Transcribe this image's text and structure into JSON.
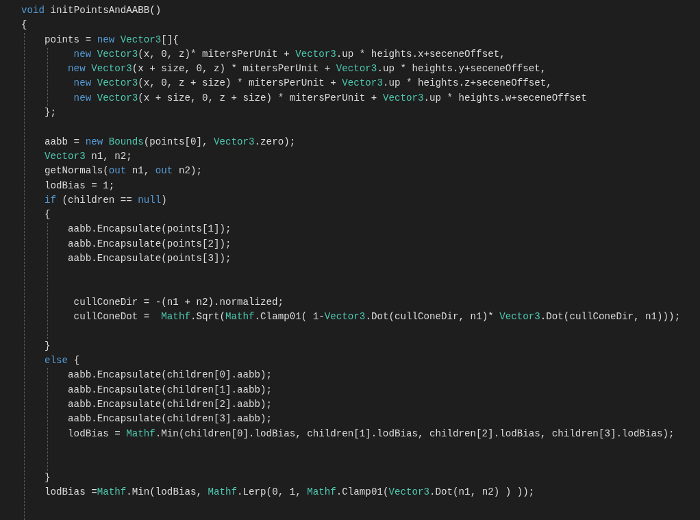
{
  "editor": {
    "lines": [
      {
        "kind": "code",
        "tokens": [
          {
            "kind": "k",
            "text": "void"
          },
          {
            "kind": "p",
            "text": " initPointsAndAABB()"
          }
        ]
      },
      {
        "kind": "code",
        "tokens": [
          {
            "kind": "p",
            "text": "{"
          }
        ]
      },
      {
        "kind": "code",
        "tokens": [
          {
            "kind": "p",
            "text": "    points = "
          },
          {
            "kind": "k",
            "text": "new"
          },
          {
            "kind": "t",
            "text": " Vector3"
          },
          {
            "kind": "p",
            "text": "[]{"
          }
        ]
      },
      {
        "kind": "code",
        "tokens": [
          {
            "kind": "k",
            "text": "         new"
          },
          {
            "kind": "t",
            "text": " Vector3"
          },
          {
            "kind": "p",
            "text": "(x, 0, z)* mitersPerUnit + "
          },
          {
            "kind": "t",
            "text": "Vector3"
          },
          {
            "kind": "p",
            "text": ".up * heights.x+seceneOffset,"
          }
        ]
      },
      {
        "kind": "code",
        "tokens": [
          {
            "kind": "k",
            "text": "        new"
          },
          {
            "kind": "t",
            "text": " Vector3"
          },
          {
            "kind": "p",
            "text": "(x + size, 0, z) * mitersPerUnit + "
          },
          {
            "kind": "t",
            "text": "Vector3"
          },
          {
            "kind": "p",
            "text": ".up * heights.y+seceneOffset,"
          }
        ]
      },
      {
        "kind": "code",
        "tokens": [
          {
            "kind": "k",
            "text": "         new"
          },
          {
            "kind": "t",
            "text": " Vector3"
          },
          {
            "kind": "p",
            "text": "(x, 0, z + size) * mitersPerUnit + "
          },
          {
            "kind": "t",
            "text": "Vector3"
          },
          {
            "kind": "p",
            "text": ".up * heights.z+seceneOffset,"
          }
        ]
      },
      {
        "kind": "code",
        "tokens": [
          {
            "kind": "k",
            "text": "         new"
          },
          {
            "kind": "t",
            "text": " Vector3"
          },
          {
            "kind": "p",
            "text": "(x + size, 0, z + size) * mitersPerUnit + "
          },
          {
            "kind": "t",
            "text": "Vector3"
          },
          {
            "kind": "p",
            "text": ".up * heights.w+seceneOffset"
          }
        ]
      },
      {
        "kind": "code",
        "tokens": [
          {
            "kind": "p",
            "text": "    };"
          }
        ]
      },
      {
        "kind": "blank"
      },
      {
        "kind": "code",
        "tokens": [
          {
            "kind": "p",
            "text": "    aabb = "
          },
          {
            "kind": "k",
            "text": "new"
          },
          {
            "kind": "t",
            "text": " Bounds"
          },
          {
            "kind": "p",
            "text": "(points[0], "
          },
          {
            "kind": "t",
            "text": "Vector3"
          },
          {
            "kind": "p",
            "text": ".zero);"
          }
        ]
      },
      {
        "kind": "code",
        "tokens": [
          {
            "kind": "t",
            "text": "    Vector3"
          },
          {
            "kind": "p",
            "text": " n1, n2;"
          }
        ]
      },
      {
        "kind": "code",
        "tokens": [
          {
            "kind": "p",
            "text": "    getNormals("
          },
          {
            "kind": "k",
            "text": "out"
          },
          {
            "kind": "p",
            "text": " n1, "
          },
          {
            "kind": "k",
            "text": "out"
          },
          {
            "kind": "p",
            "text": " n2);"
          }
        ]
      },
      {
        "kind": "code",
        "tokens": [
          {
            "kind": "p",
            "text": "    lodBias = 1;"
          }
        ]
      },
      {
        "kind": "code",
        "tokens": [
          {
            "kind": "k",
            "text": "    if"
          },
          {
            "kind": "p",
            "text": " (children == "
          },
          {
            "kind": "k",
            "text": "null"
          },
          {
            "kind": "p",
            "text": ")"
          }
        ]
      },
      {
        "kind": "code",
        "tokens": [
          {
            "kind": "p",
            "text": "    {"
          }
        ]
      },
      {
        "kind": "code",
        "tokens": [
          {
            "kind": "p",
            "text": "        aabb.Encapsulate(points[1]);"
          }
        ]
      },
      {
        "kind": "code",
        "tokens": [
          {
            "kind": "p",
            "text": "        aabb.Encapsulate(points[2]);"
          }
        ]
      },
      {
        "kind": "code",
        "tokens": [
          {
            "kind": "p",
            "text": "        aabb.Encapsulate(points[3]);"
          }
        ]
      },
      {
        "kind": "blank"
      },
      {
        "kind": "blank"
      },
      {
        "kind": "code",
        "tokens": [
          {
            "kind": "p",
            "text": "         cullConeDir = -(n1 + n2).normalized;"
          }
        ]
      },
      {
        "kind": "code",
        "tokens": [
          {
            "kind": "p",
            "text": "         cullConeDot =  "
          },
          {
            "kind": "t",
            "text": "Mathf"
          },
          {
            "kind": "p",
            "text": ".Sqrt("
          },
          {
            "kind": "t",
            "text": "Mathf"
          },
          {
            "kind": "p",
            "text": ".Clamp01( 1-"
          },
          {
            "kind": "t",
            "text": "Vector3"
          },
          {
            "kind": "p",
            "text": ".Dot(cullConeDir, n1)* "
          },
          {
            "kind": "t",
            "text": "Vector3"
          },
          {
            "kind": "p",
            "text": ".Dot(cullConeDir, n1)));"
          }
        ]
      },
      {
        "kind": "blank"
      },
      {
        "kind": "code",
        "tokens": [
          {
            "kind": "p",
            "text": "    }"
          }
        ]
      },
      {
        "kind": "code",
        "tokens": [
          {
            "kind": "k",
            "text": "    else"
          },
          {
            "kind": "p",
            "text": " {"
          }
        ]
      },
      {
        "kind": "code",
        "tokens": [
          {
            "kind": "p",
            "text": "        aabb.Encapsulate(children[0].aabb);"
          }
        ]
      },
      {
        "kind": "code",
        "tokens": [
          {
            "kind": "p",
            "text": "        aabb.Encapsulate(children[1].aabb);"
          }
        ]
      },
      {
        "kind": "code",
        "tokens": [
          {
            "kind": "p",
            "text": "        aabb.Encapsulate(children[2].aabb);"
          }
        ]
      },
      {
        "kind": "code",
        "tokens": [
          {
            "kind": "p",
            "text": "        aabb.Encapsulate(children[3].aabb);"
          }
        ]
      },
      {
        "kind": "code",
        "tokens": [
          {
            "kind": "p",
            "text": "        lodBias = "
          },
          {
            "kind": "t",
            "text": "Mathf"
          },
          {
            "kind": "p",
            "text": ".Min(children[0].lodBias, children[1].lodBias, children[2].lodBias, children[3].lodBias);"
          }
        ]
      },
      {
        "kind": "blank"
      },
      {
        "kind": "blank"
      },
      {
        "kind": "code",
        "tokens": [
          {
            "kind": "p",
            "text": "    }"
          }
        ]
      },
      {
        "kind": "code",
        "tokens": [
          {
            "kind": "p",
            "text": "    lodBias ="
          },
          {
            "kind": "t",
            "text": "Mathf"
          },
          {
            "kind": "p",
            "text": ".Min(lodBias, "
          },
          {
            "kind": "t",
            "text": "Mathf"
          },
          {
            "kind": "p",
            "text": ".Lerp(0, 1, "
          },
          {
            "kind": "t",
            "text": "Mathf"
          },
          {
            "kind": "p",
            "text": ".Clamp01("
          },
          {
            "kind": "t",
            "text": "Vector3"
          },
          {
            "kind": "p",
            "text": ".Dot(n1, n2) ) ));"
          }
        ]
      }
    ]
  }
}
